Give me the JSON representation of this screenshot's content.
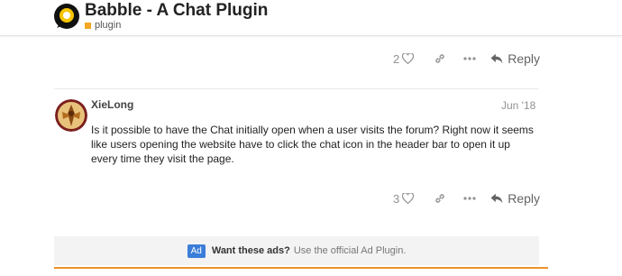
{
  "topic": {
    "title": "Babble - A Chat Plugin",
    "category": "plugin",
    "category_color": "#f5a623"
  },
  "post1_controls": {
    "like_count": "2",
    "reply_label": "Reply"
  },
  "post2": {
    "username": "XieLong",
    "date": "Jun '18",
    "body": "Is it possible to have the Chat initially open when a user visits the forum? Right now it seems like users opening the website have to click the chat icon in the header bar to open it up every time they visit the page.",
    "like_count": "3",
    "reply_label": "Reply"
  },
  "ad": {
    "badge": "Ad",
    "headline": "Want these ads?",
    "text": "Use the official Ad Plugin."
  },
  "colors": {
    "accent_orange": "#f0912c",
    "ad_badge": "#3b7dd8"
  },
  "icons": [
    "logo-icon",
    "heart-icon",
    "link-icon",
    "more-icon",
    "reply-icon"
  ]
}
